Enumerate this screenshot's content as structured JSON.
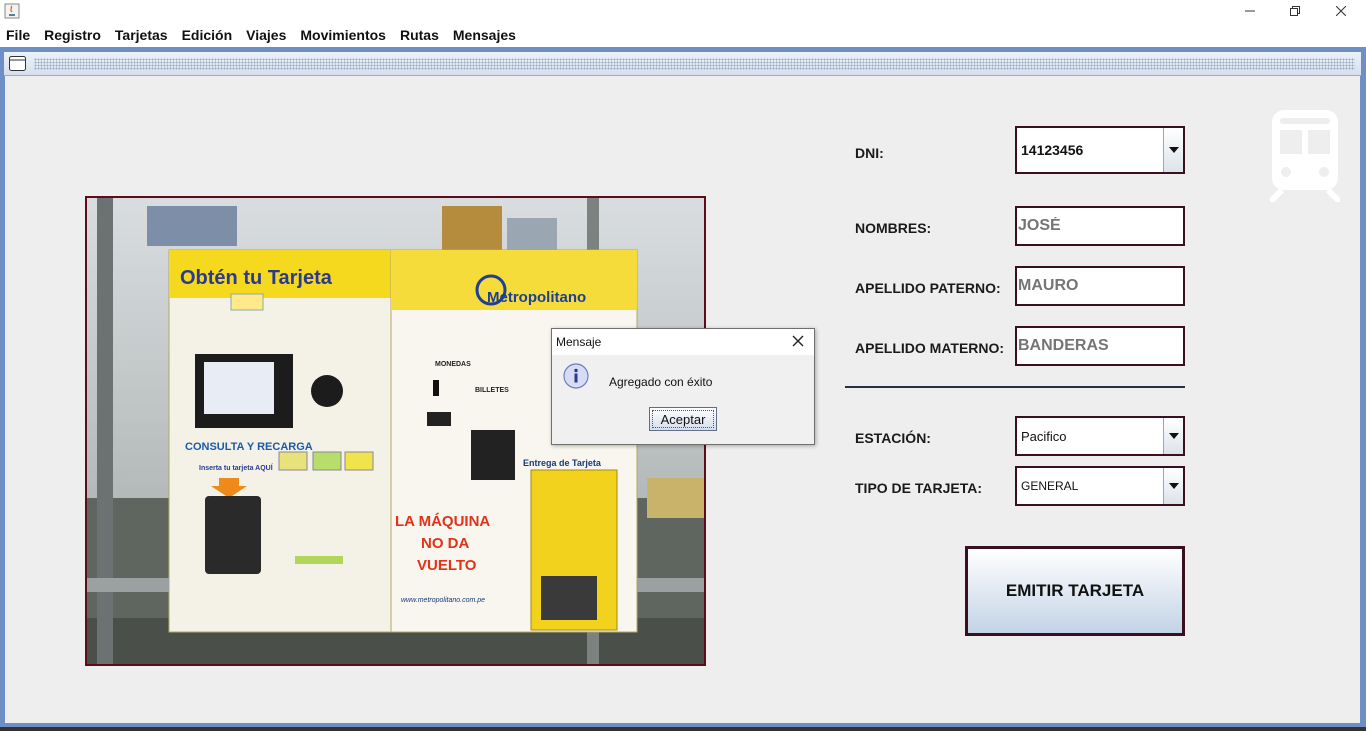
{
  "menu": [
    "File",
    "Registro",
    "Tarjetas",
    "Edición",
    "Viajes",
    "Movimientos",
    "Rutas",
    "Mensajes"
  ],
  "form": {
    "dni_label": "DNI:",
    "dni_value": "14123456",
    "nombres_label": "NOMBRES:",
    "nombres_placeholder": "JOSÉ",
    "apellido_paterno_label": "APELLIDO PATERNO:",
    "apellido_paterno_placeholder": "MAURO",
    "apellido_materno_label": "APELLIDO MATERNO:",
    "apellido_materno_placeholder": "BANDERAS",
    "estacion_label": "ESTACIÓN:",
    "estacion_value": "Pacifico",
    "tipo_label": "TIPO DE TARJETA:",
    "tipo_value": "GENERAL",
    "emit_button": "EMITIR TARJETA"
  },
  "photo": {
    "headline": "Obtén tu Tarjeta",
    "brand": "Metropolitano",
    "monedas": "MONEDAS",
    "billetes": "BILLETES",
    "consulta": "CONSULTA Y RECARGA",
    "inserta": "Inserta tu tarjeta AQUÍ",
    "entrega": "Entrega de Tarjeta",
    "no_vuelto_1": "LA MÁQUINA",
    "no_vuelto_2": "NO DA",
    "no_vuelto_3": "VUELTO",
    "web": "www.metropolitano.com.pe"
  },
  "dialog": {
    "title": "Mensaje",
    "message": "Agregado con éxito",
    "button": "Aceptar"
  },
  "icons": [
    "java-app-icon",
    "minimize-icon",
    "restore-icon",
    "close-icon",
    "window-icon",
    "train-icon",
    "info-icon"
  ]
}
